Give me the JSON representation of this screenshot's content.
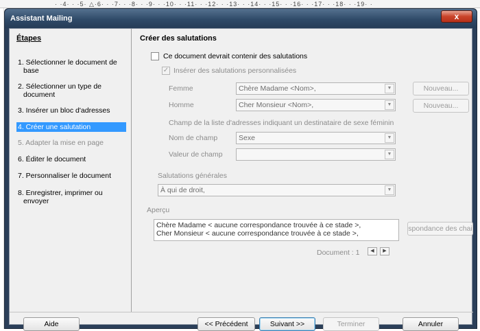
{
  "ruler": {
    "text": "· ·4· · ·5· △·6· · ·7· · ·8· · ·9· · ·10· · ·11· · ·12· · ·13· · ·14· · ·15· · ·16· · ·17· · ·18· · ·19· ·"
  },
  "window": {
    "title": "Assistant Mailing",
    "close_label": "x"
  },
  "steps": {
    "heading": "Étapes",
    "items": [
      {
        "line1": "1. Sélectionner le document de",
        "line2": "base"
      },
      {
        "line1": "2. Sélectionner un type de",
        "line2": "document"
      },
      {
        "line1": "3. Insérer un bloc d'adresses",
        "line2": ""
      },
      {
        "line1": "4. Créer une salutation",
        "line2": ""
      },
      {
        "line1": "5. Adapter la mise en page",
        "line2": ""
      },
      {
        "line1": "6. Éditer le document",
        "line2": ""
      },
      {
        "line1": "7. Personnaliser le document",
        "line2": ""
      },
      {
        "line1": "8. Enregistrer, imprimer ou",
        "line2": "envoyer"
      }
    ]
  },
  "main": {
    "heading": "Créer des salutations",
    "contains_salutations": {
      "label": "Ce document devrait contenir des salutations",
      "checked": false
    },
    "personalized": {
      "label": "Insérer des salutations personnalisées",
      "checked": true
    },
    "femme": {
      "label": "Femme",
      "value": "Chère Madame <Nom>,",
      "new_button": "Nouveau..."
    },
    "homme": {
      "label": "Homme",
      "value": "Cher Monsieur <Nom>,",
      "new_button": "Nouveau..."
    },
    "field_caption": "Champ de la liste d'adresses indiquant un destinataire de sexe féminin",
    "field_name": {
      "label": "Nom de champ",
      "value": "Sexe"
    },
    "field_value": {
      "label": "Valeur de champ",
      "value": ""
    },
    "general": {
      "label": "Salutations générales",
      "value": "À qui de droit,"
    },
    "preview": {
      "label": "Aperçu",
      "line1": "Chère Madame < aucune correspondance trouvée à ce stade >,",
      "line2": "Cher Monsieur < aucune correspondance trouvée à ce stade >,",
      "match_button": "spondance des chai",
      "document_label": "Document : 1"
    }
  },
  "footer": {
    "help": "Aide",
    "previous": "<< Précédent",
    "next": "Suivant >>",
    "finish": "Terminer",
    "cancel": "Annuler"
  }
}
